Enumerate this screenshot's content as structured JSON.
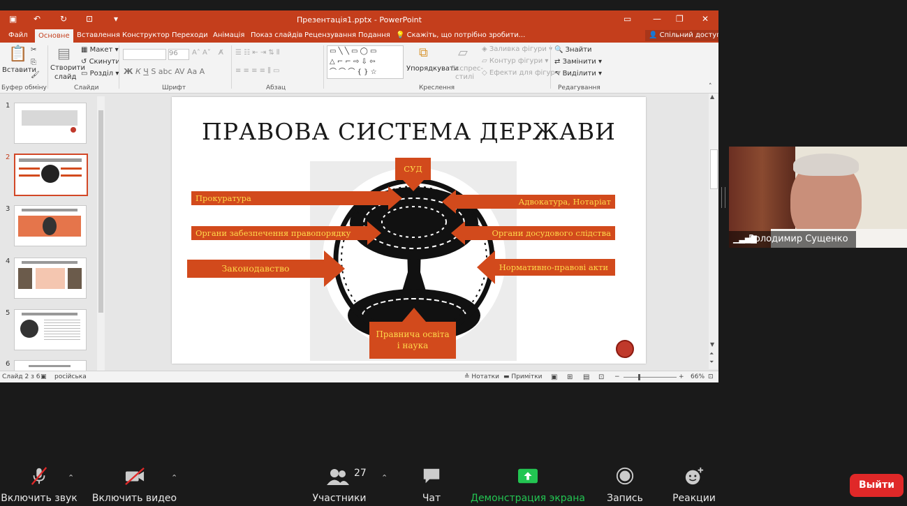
{
  "window": {
    "title": "Презентація1.pptx - PowerPoint"
  },
  "menu": {
    "tabs": [
      "Файл",
      "Основне",
      "Вставлення",
      "Конструктор",
      "Переходи",
      "Анімація",
      "Показ слайдів",
      "Рецензування",
      "Подання"
    ],
    "active_tab": "Основне",
    "tell_me": "Скажіть, що потрібно зробити...",
    "share": "Спільний доступ"
  },
  "ribbon": {
    "paste": "Вставити",
    "clipboard_group": "Буфер обміну",
    "new_slide_1": "Створити",
    "new_slide_2": "слайд",
    "layout": "Макет",
    "reset": "Скинути",
    "sections": "Розділ",
    "slides_group": "Слайди",
    "font_size": "96",
    "font_group": "Шрифт",
    "paragraph_group": "Абзац",
    "arrange": "Упорядкувати",
    "quick_styles_1": "Експрес-",
    "quick_styles_2": "стилі",
    "shape_fill": "Заливка фігури",
    "shape_outline": "Контур фігури",
    "shape_effects": "Ефекти для фігур",
    "drawing_group": "Креслення",
    "find": "Знайти",
    "replace": "Замінити",
    "select": "Виділити",
    "editing_group": "Редагування"
  },
  "slide": {
    "title": "ПРАВОВА СИСТЕМА ДЕРЖАВИ",
    "labels": {
      "court": "СУД",
      "prosecution": "Прокуратура",
      "advocacy": "Адвокатура, Нотаріат",
      "law_order": "Органи забезпечення правопорядку",
      "pretrial": "Органи досудового слідства",
      "legislation": "Законодавство",
      "normative": "Нормативно-правові акти",
      "education_1": "Правнича освіта",
      "education_2": "і наука"
    }
  },
  "thumbnails": [
    "1",
    "2",
    "3",
    "4",
    "5",
    "6"
  ],
  "status": {
    "slide_counter": "Слайд 2 з 6",
    "language": "російська",
    "notes": "Нотатки",
    "comments": "Примітки",
    "zoom": "66%"
  },
  "video": {
    "name": "Володимир Сущенко"
  },
  "zoom_toolbar": {
    "unmute": "Включить звук",
    "start_video": "Включить видео",
    "participants": "Участники",
    "participants_count": "27",
    "chat": "Чат",
    "share_screen": "Демонстрация экрана",
    "record": "Запись",
    "reactions": "Реакции",
    "leave": "Выйти"
  },
  "colors": {
    "ppt_accent": "#c43e1c",
    "slide_label_bg": "#d24a1c",
    "slide_label_text": "#ffd84a",
    "share_green": "#23c552",
    "leave_red": "#e02828"
  }
}
